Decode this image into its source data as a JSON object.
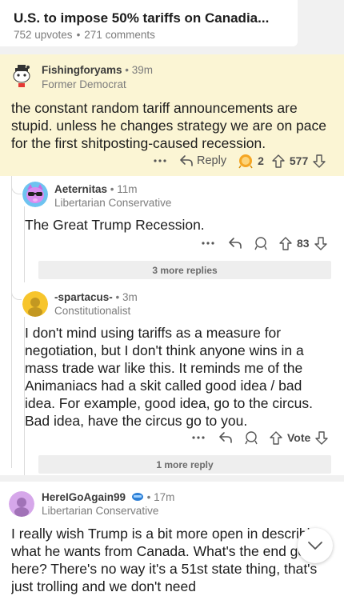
{
  "post": {
    "title": "U.S. to impose 50% tariffs on Canadia...",
    "upvotes": "752 upvotes",
    "comments": "271 comments",
    "separator": "•"
  },
  "comments": [
    {
      "username": "Fishingforyams",
      "age": "39m",
      "flair": "Former Democrat",
      "body": "the constant random tariff announcements are stupid. unless he changes strategy we are on pace for the first shitposting-caused recession.",
      "reply_label": "Reply",
      "award_count": "2",
      "score": "577",
      "more_icon": "more-dots-icon"
    },
    {
      "username": "Aeternitas",
      "age": "11m",
      "flair": "Libertarian Conservative",
      "body": "The Great Trump Recession.",
      "score": "83",
      "more_replies": "3 more replies"
    },
    {
      "username": "-spartacus-",
      "age": "3m",
      "flair": "Constitutionalist",
      "body": "I don't mind using tariffs as a measure for negotiation, but I don't think anyone wins in a mass trade war like this.  It reminds me of the Animaniacs had a skit called good idea / bad idea.  For example, good idea, go to the circus. Bad idea, have the circus go to you.",
      "score": "Vote",
      "more_replies": "1 more reply"
    },
    {
      "username": "HereIGoAgain99",
      "age": "17m",
      "flair": "Libertarian Conservative",
      "body": "I really wish Trump is a bit more open in describing what he wants from Canada. What's the end goal, here? There's no way it's a 51st state thing, that's just trolling and we don't need"
    }
  ],
  "colors": {
    "highlight": "#fbf5d4",
    "award": "#f5a623"
  }
}
